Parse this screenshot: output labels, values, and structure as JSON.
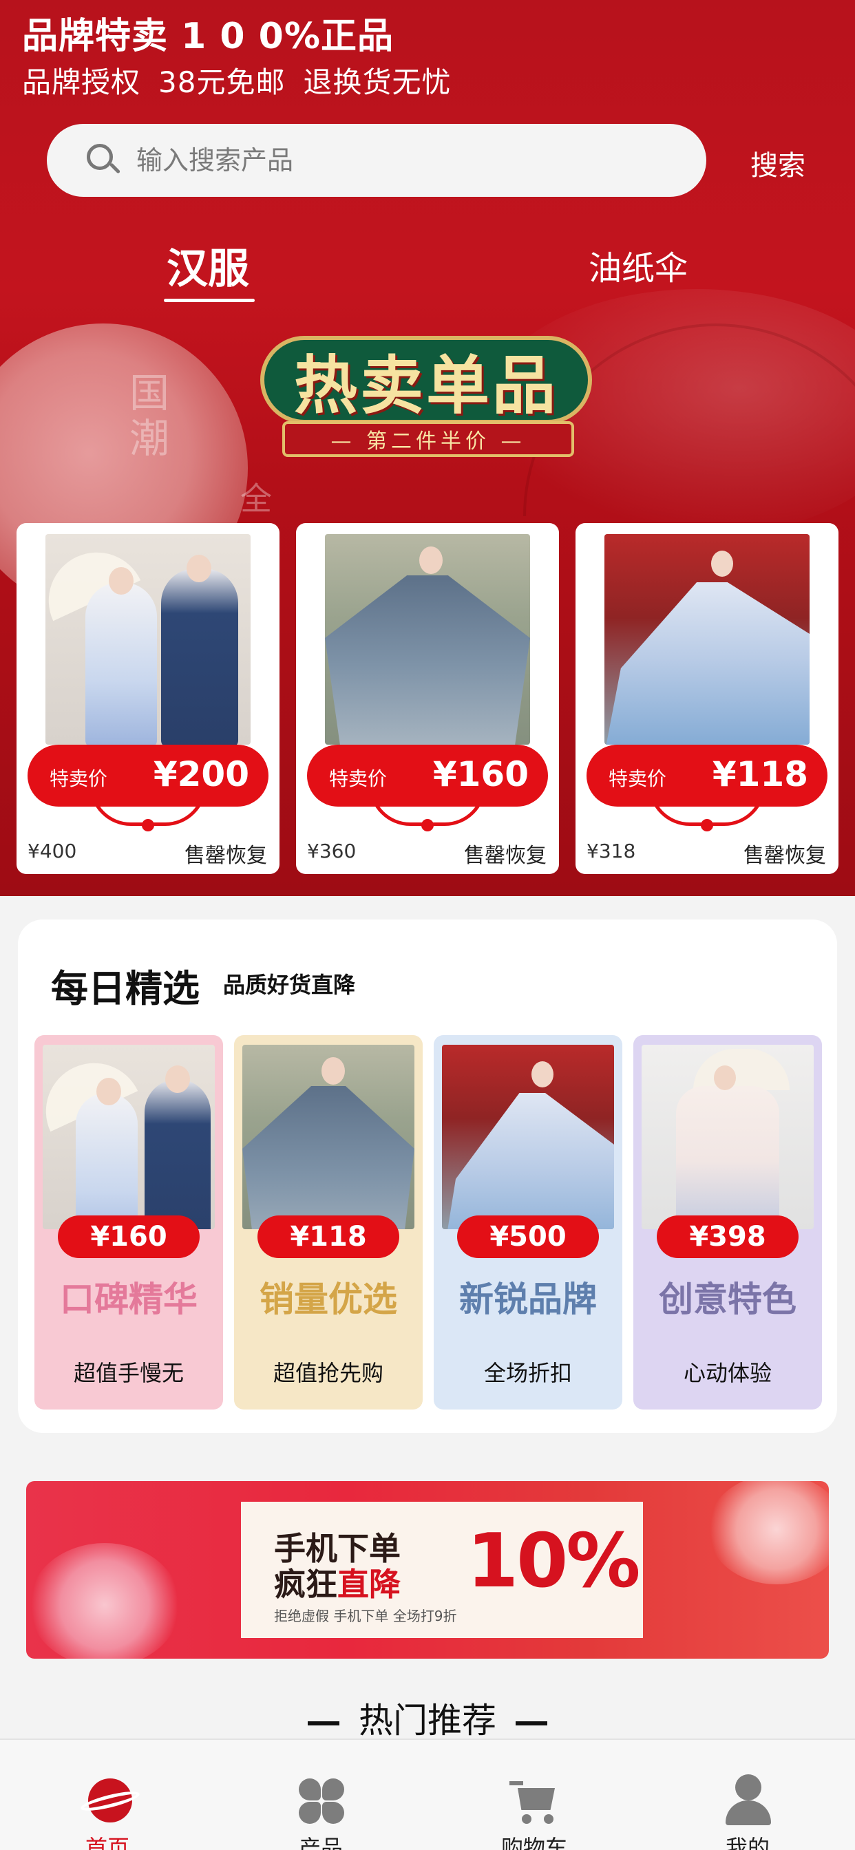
{
  "header": {
    "title": "品牌特卖 1 0 0%正品",
    "subtitle_items": [
      "品牌授权",
      "38元免邮",
      "退换货无忧"
    ]
  },
  "search": {
    "placeholder": "输入搜索产品",
    "button_label": "搜索"
  },
  "tabs": [
    {
      "label": "汉服",
      "active": true
    },
    {
      "label": "油纸伞",
      "active": false
    }
  ],
  "hero_banner": {
    "title": "热卖单品",
    "subtitle": "— 第二件半价 —",
    "background_text": [
      "国潮",
      "全"
    ]
  },
  "hero_products": [
    {
      "price_label": "特卖价",
      "price": "¥200",
      "original_price": "¥400",
      "status": "售罄恢复"
    },
    {
      "price_label": "特卖价",
      "price": "¥160",
      "original_price": "¥360",
      "status": "售罄恢复"
    },
    {
      "price_label": "特卖价",
      "price": "¥118",
      "original_price": "¥318",
      "status": "售罄恢复"
    }
  ],
  "daily_picks": {
    "title": "每日精选",
    "subtitle": "品质好货直降",
    "items": [
      {
        "price": "¥160",
        "name": "口碑精华",
        "tag": "超值手慢无",
        "bg": "#f8c9d3",
        "name_color": "#e4799a"
      },
      {
        "price": "¥118",
        "name": "销量优选",
        "tag": "超值抢先购",
        "bg": "#f6e7c6",
        "name_color": "#d4a548"
      },
      {
        "price": "¥500",
        "name": "新锐品牌",
        "tag": "全场折扣",
        "bg": "#dbe7f6",
        "name_color": "#5e7fad"
      },
      {
        "price": "¥398",
        "name": "创意特色",
        "tag": "心动体验",
        "bg": "#ddd5f2",
        "name_color": "#7b74a8"
      }
    ]
  },
  "promo_banner": {
    "line1": "手机下单",
    "line2_prefix": "疯狂",
    "line2_highlight": "直降",
    "percent": "10%",
    "fine_print": "拒绝虚假 手机下单 全场打9折"
  },
  "hot_section": {
    "title": "热门推荐"
  },
  "bottom_nav": [
    {
      "label": "首页",
      "icon": "planet-icon",
      "active": true
    },
    {
      "label": "产品",
      "icon": "clover-icon",
      "active": false
    },
    {
      "label": "购物车",
      "icon": "cart-icon",
      "active": false
    },
    {
      "label": "我的",
      "icon": "user-icon",
      "active": false
    }
  ],
  "colors": {
    "brand_red": "#c3141e",
    "price_red": "#e30f16",
    "active_nav": "#d6121f"
  }
}
